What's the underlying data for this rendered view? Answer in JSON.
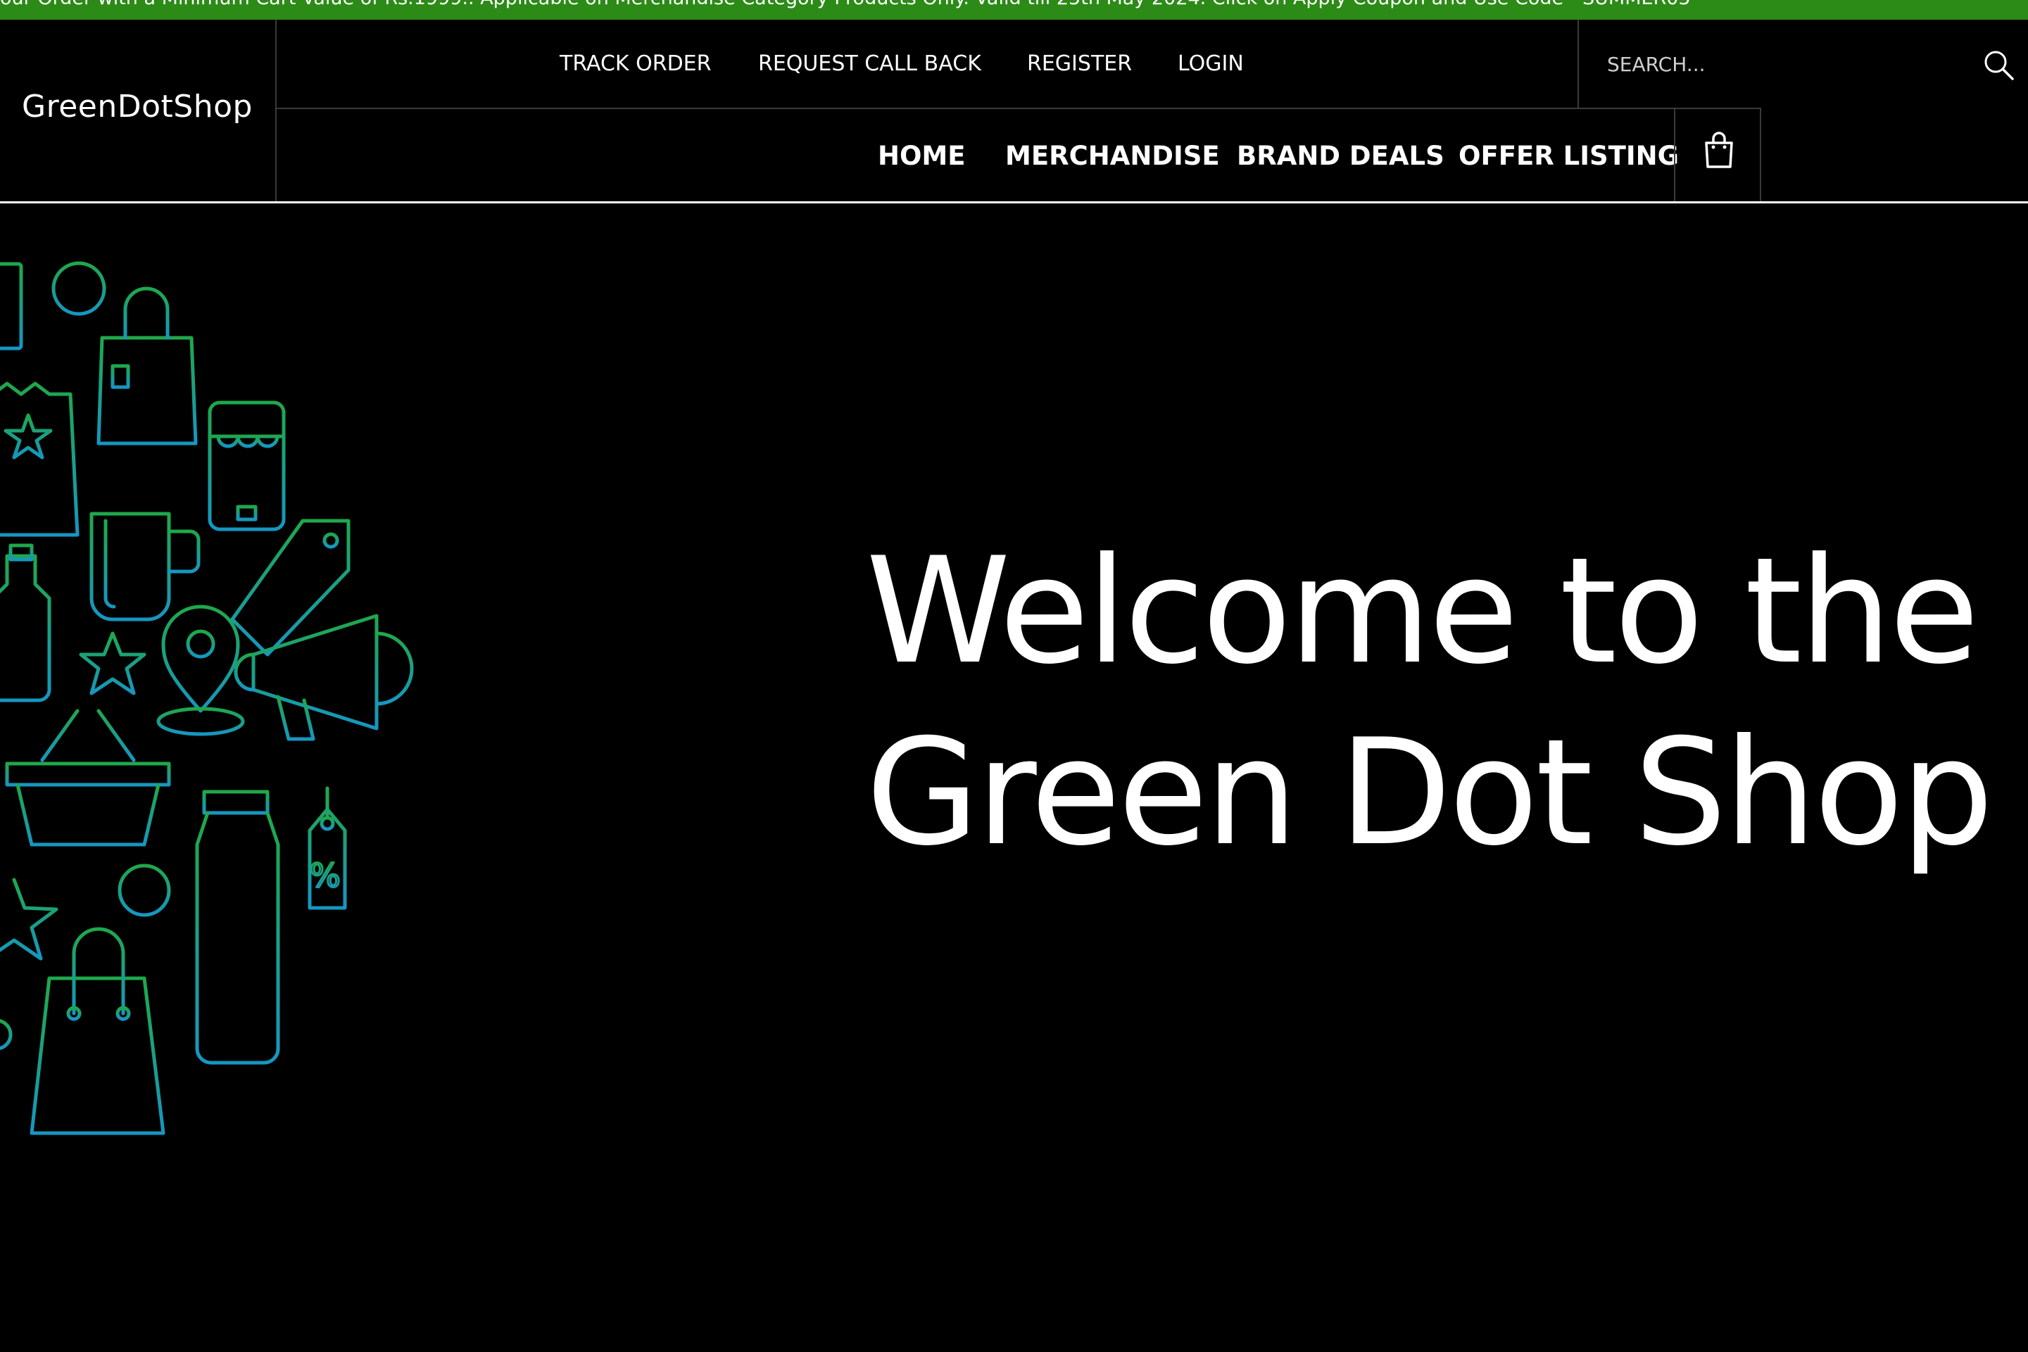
{
  "promo_bar": {
    "text": "our Order with a Minimum Cart Value of Rs.1999.. Applicable on Merchandise Category Products Only. Valid till 25th May 2024. Click on Apply Coupon and Use Code - SUMMER05",
    "background": "#2c8a17"
  },
  "brand": {
    "logo_text": "GreenDotShop"
  },
  "top_links": [
    "TRACK ORDER",
    "REQUEST CALL BACK",
    "REGISTER",
    "LOGIN"
  ],
  "search": {
    "placeholder": "SEARCH..."
  },
  "main_nav": [
    "HOME",
    "MERCHANDISE",
    "BRAND DEALS",
    "OFFER LISTING"
  ],
  "icons": {
    "search": "search-icon",
    "cart": "shopping-bag-icon"
  },
  "hero": {
    "line1": "Welcome to the",
    "line2": "Green Dot Shop",
    "art_gradient": [
      "#1fa84a",
      "#1597c2"
    ]
  }
}
